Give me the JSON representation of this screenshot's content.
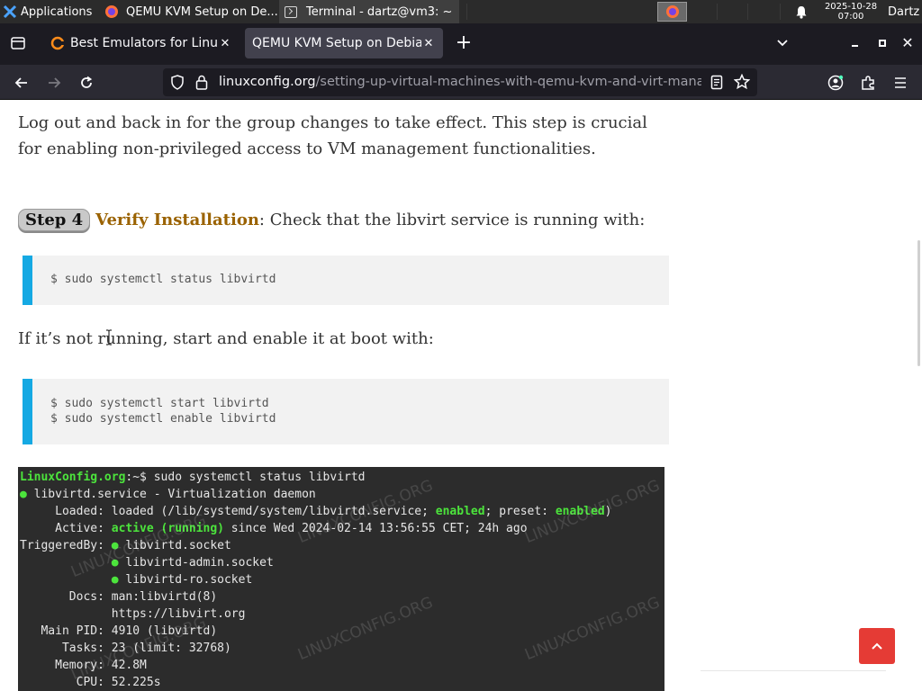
{
  "os_panel": {
    "applications_label": "Applications",
    "task1_title": "QEMU KVM Setup on De...",
    "task2_title": "Terminal - dartz@vm3: ~",
    "clock_date": "2025-10-28",
    "clock_time": "07:00",
    "user": "Dartz"
  },
  "browser": {
    "tabs": [
      {
        "title": "Best Emulators for Linux",
        "active": false
      },
      {
        "title": "QEMU KVM Setup on Debian",
        "active": true
      }
    ],
    "url_host": "linuxconfig.org",
    "url_path": "/setting-up-virtual-machines-with-qemu-kvm-and-virt-manager"
  },
  "page": {
    "paragraph_1": "Log out and back in for the group changes to take effect. This step is crucial for enabling non-privileged access to VM management functionalities.",
    "step_badge": "Step 4",
    "step_title": "Verify Installation",
    "step_text": ": Check that the libvirt service is running with:",
    "code_1": "$ sudo systemctl status libvirtd",
    "paragraph_2": "If it’s not running, start and enable it at boot with:",
    "code_2_line_1": "$ sudo systemctl start libvirtd",
    "code_2_line_2": "$ sudo systemctl enable libvirtd",
    "terminal": {
      "prompt_host": "LinuxConfig.org",
      "prompt_rest": ":~$ sudo systemctl status libvirtd",
      "service_dot": "●",
      "service_line": " libvirtd.service - Virtualization daemon",
      "loaded_prefix": "     Loaded: loaded (/lib/systemd/system/libvirtd.service; ",
      "loaded_enabled": "enabled",
      "loaded_mid": "; preset: ",
      "loaded_preset": "enabled",
      "loaded_suffix": ")",
      "active_prefix": "     Active: ",
      "active_state": "active (running)",
      "active_suffix": " since Wed 2024-02-14 13:56:55 CET; 24h ago",
      "triggered_prefix": "TriggeredBy: ",
      "triggered_1": "libvirtd.socket",
      "triggered_2": "libvirtd-admin.socket",
      "triggered_3": "libvirtd-ro.socket",
      "docs_1": "       Docs: man:libvirtd(8)",
      "docs_2": "             https://libvirt.org",
      "main_pid": "   Main PID: 4910 (libvirtd)",
      "tasks": "      Tasks: 23 (limit: 32768)",
      "memory": "     Memory: 42.8M",
      "cpu": "        CPU: 52.225s",
      "watermark": "LINUXCONFIG.ORG"
    }
  },
  "colors": {
    "step_title": "#9a6200",
    "code_accent": "#15a9e3",
    "terminal_green": "#4ce43c",
    "scroll_top_button": "#e53b35"
  },
  "icons": [
    "xfce-logo-icon",
    "firefox-icon",
    "terminal-icon",
    "bell-icon",
    "tab-list-icon",
    "close-icon",
    "plus-icon",
    "chevron-down-icon",
    "minimize-icon",
    "maximize-icon",
    "back-arrow-icon",
    "forward-arrow-icon",
    "reload-icon",
    "shield-icon",
    "lock-icon",
    "reader-view-icon",
    "star-icon",
    "account-icon",
    "extensions-icon",
    "hamburger-menu-icon",
    "chevron-up-icon"
  ]
}
